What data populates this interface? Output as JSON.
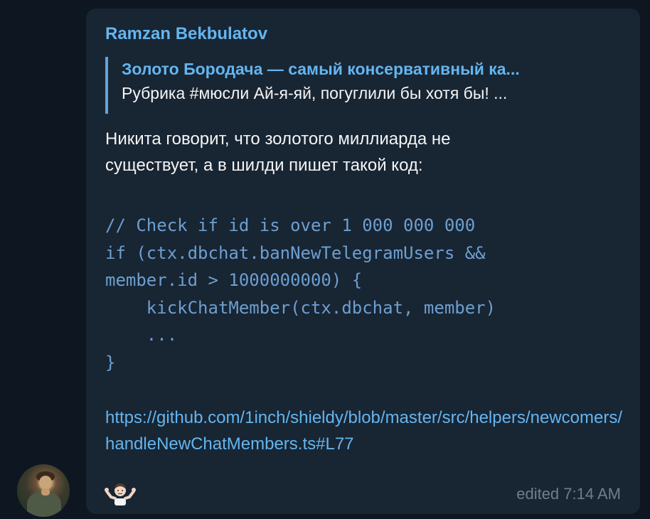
{
  "message": {
    "sender": "Ramzan Bekbulatov",
    "reply": {
      "title": "Золото Бородача — самый консервативный ка...",
      "text": "Рубрика #мюсли  Ай-я-яй, погуглили бы хотя бы! ..."
    },
    "text_lines": [
      "Никита говорит, что золотого миллиарда не",
      "существует, а в шилди пишет такой код:"
    ],
    "code": "// Check if id is over 1 000 000 000\nif (ctx.dbchat.banNewTelegramUsers &&\nmember.id > 1000000000) {\n    kickChatMember(ctx.dbchat, member)\n    ...\n}",
    "link": "https://github.com/1inch/shieldy/blob/master/src/helpers/newcomers/handleNewChatMembers.ts#L77",
    "emoji": "person-shrugging-emoji",
    "edited_label": "edited 7:14 AM"
  },
  "colors": {
    "background": "#0e1621",
    "bubble": "#182533",
    "accent": "#64b5ef",
    "code": "#6d9fd0",
    "meta": "#6d7f8f",
    "text": "#f5f5f5"
  }
}
